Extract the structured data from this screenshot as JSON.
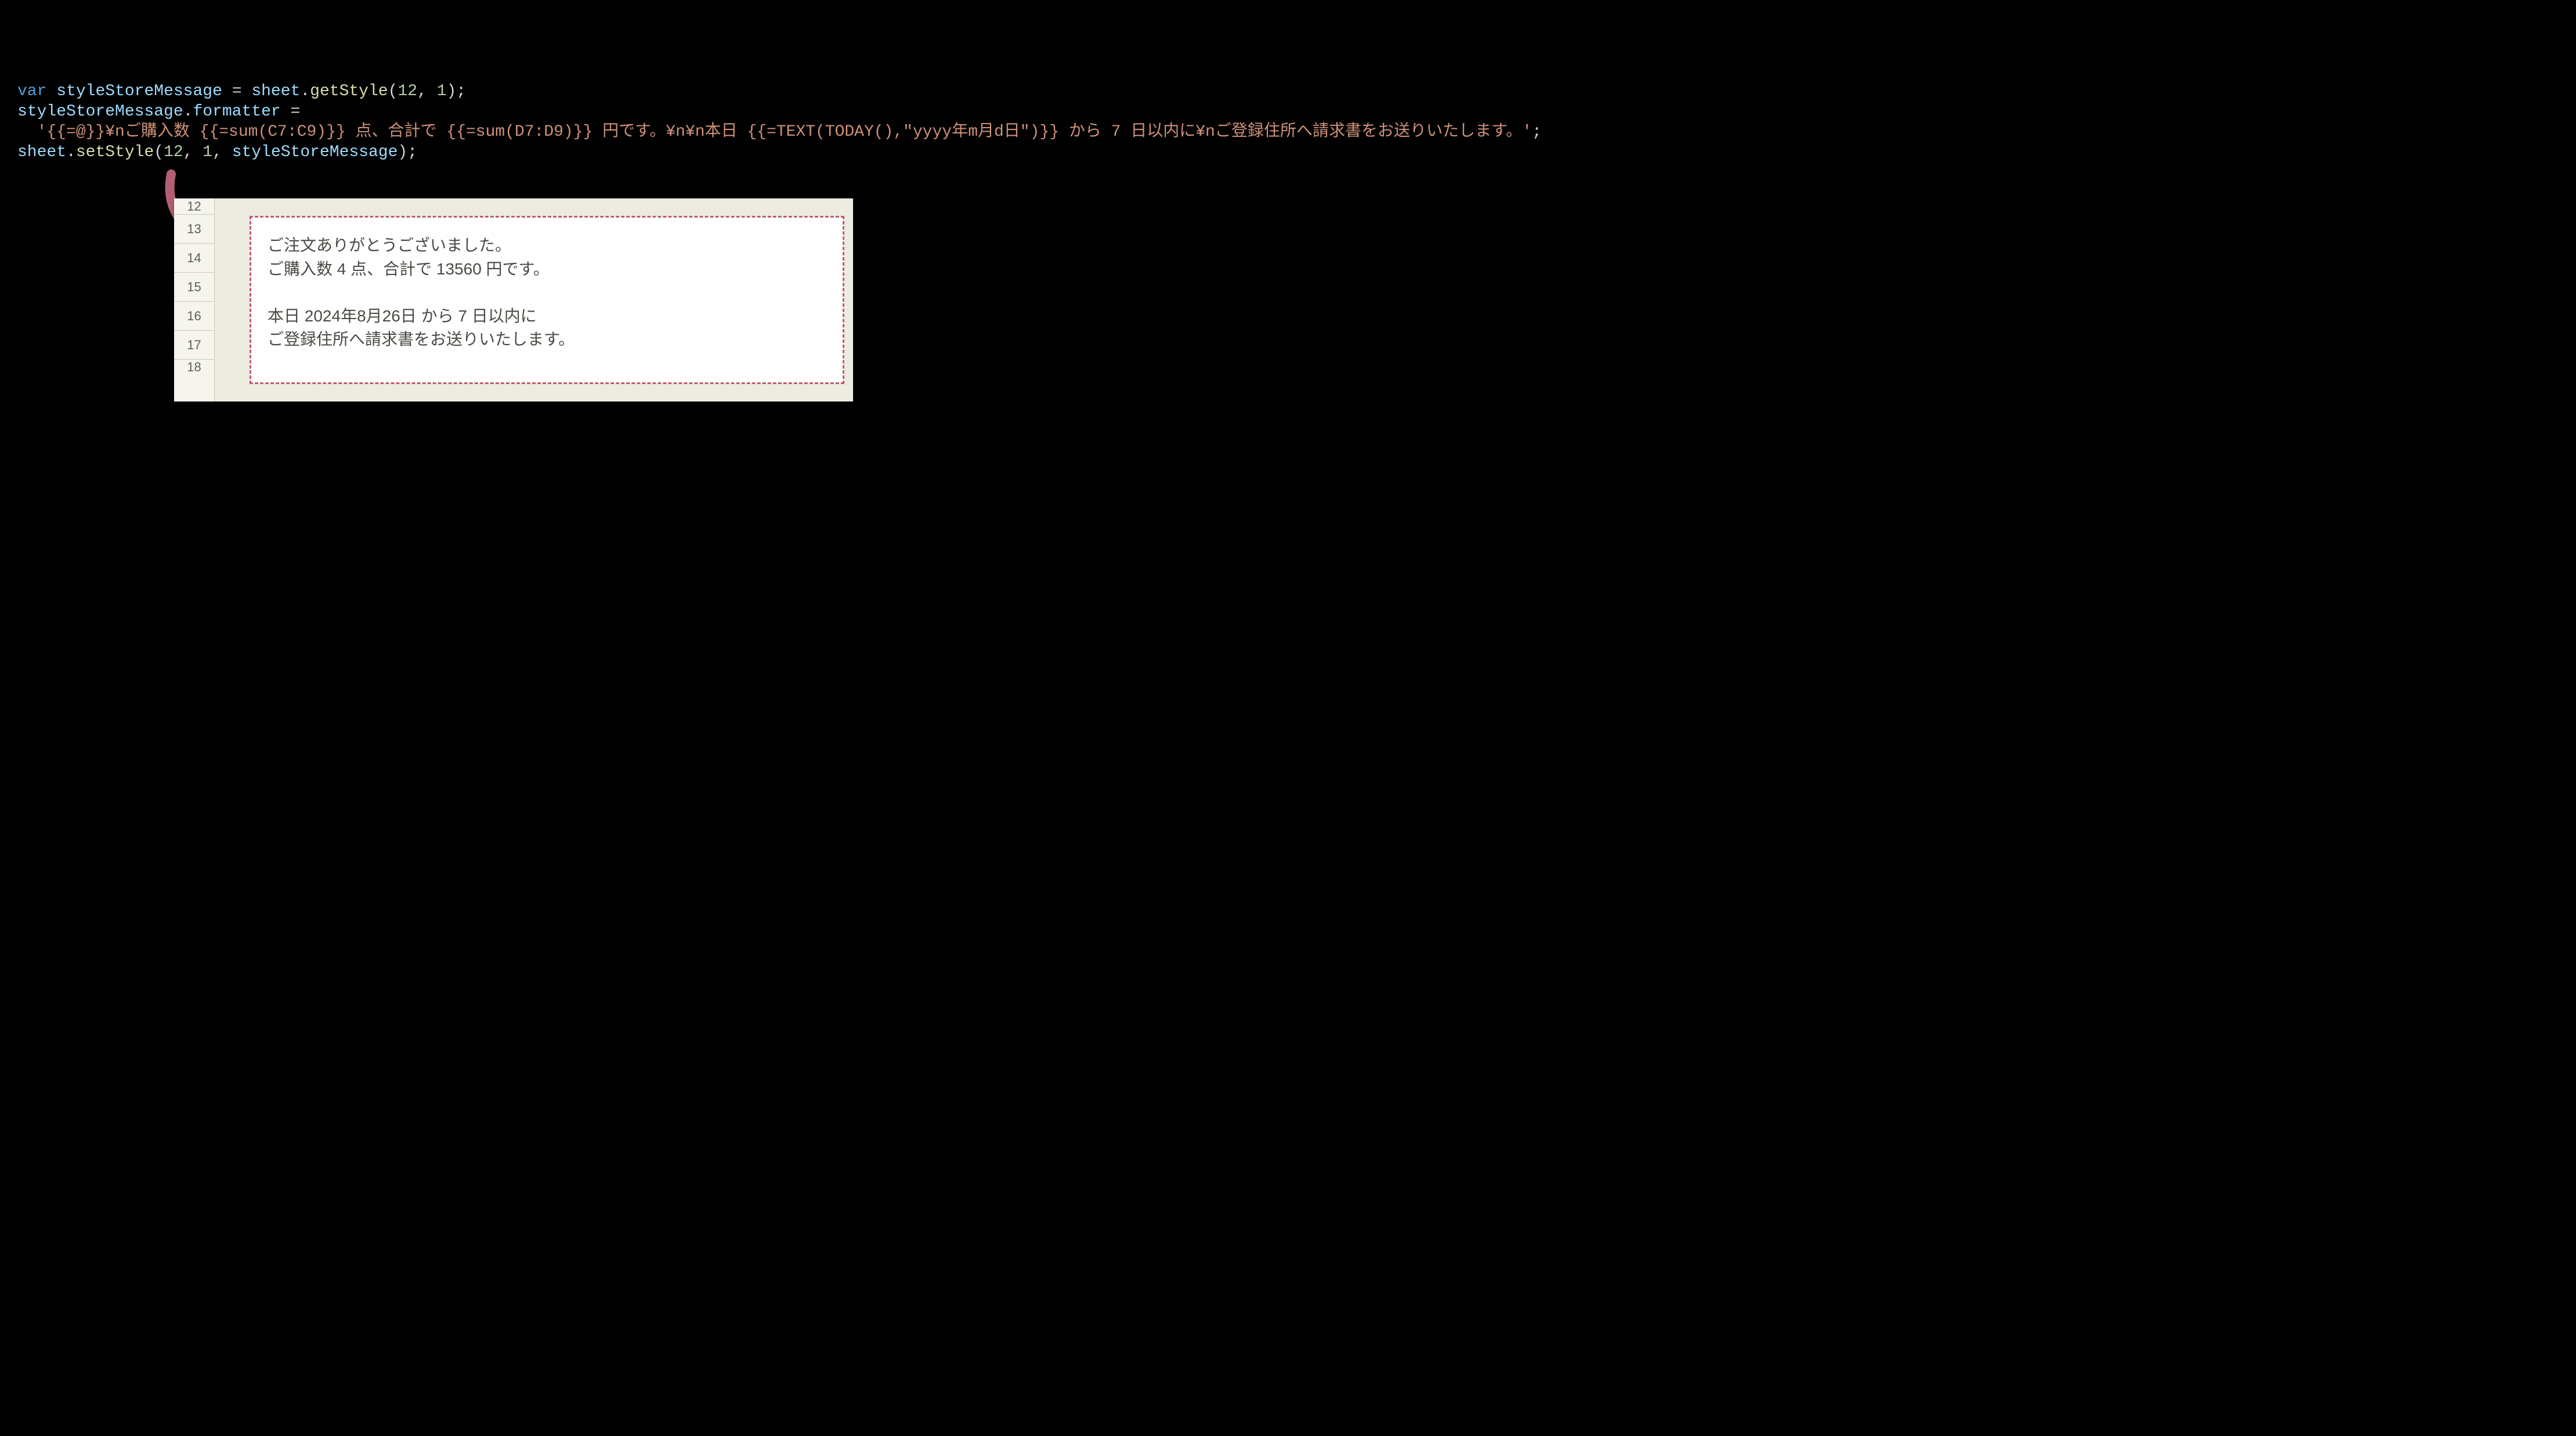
{
  "code": {
    "kw_var": "var",
    "var_styleStoreMessage": "styleStoreMessage",
    "var_sheet": "sheet",
    "method_getStyle": "getStyle",
    "num_12": "12",
    "num_1": "1",
    "prop_formatter": "formatter",
    "str_part1": "'{{=@}}¥nご購入数 {{=sum(C7:C9)}} 点、合計で {{=sum(D7:D9)}} 円です。¥n¥n本日 {{=TEXT(TODAY(),\"yyyy年m月d日\")}} から 7 日以内に¥nご登録住所へ請求書をお送りいたします。'",
    "method_setStyle": "setStyle"
  },
  "sheet": {
    "rows": [
      "12",
      "13",
      "14",
      "15",
      "16",
      "17",
      "18"
    ]
  },
  "message": {
    "line1": "ご注文ありがとうございました。",
    "line2": "ご購入数 4 点、合計で 13560 円です。",
    "line3": "本日 2024年8月26日 から 7 日以内に",
    "line4": "ご登録住所へ請求書をお送りいたします。"
  },
  "colors": {
    "dashBorder": "#c25b6b",
    "arrow": "#b25f72"
  }
}
